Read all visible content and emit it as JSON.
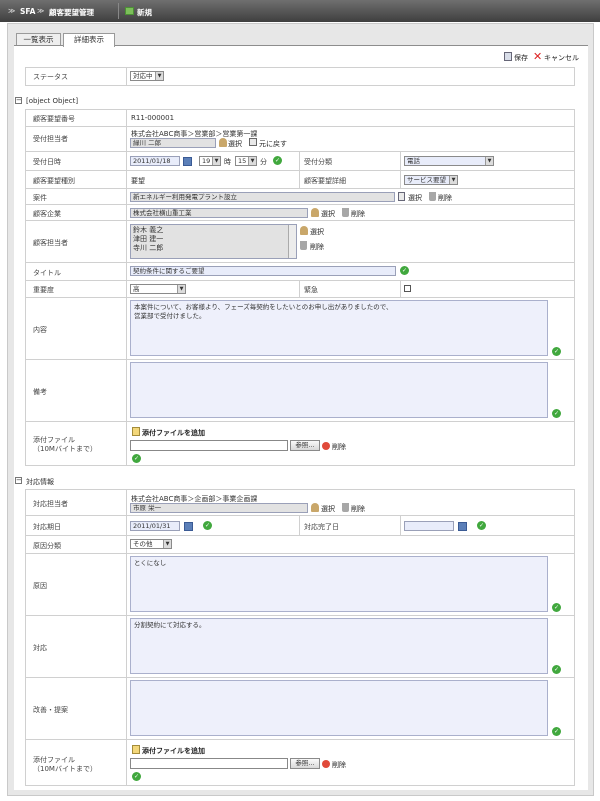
{
  "header": {
    "app": "SFA",
    "module": "顧客要望管理",
    "new_tab": "新規"
  },
  "tabs": [
    {
      "label": "一覧表示"
    },
    {
      "label": "詳細表示"
    }
  ],
  "toolbar": {
    "save": "保存",
    "cancel": "キャンセル"
  },
  "status": {
    "label": "ステータス",
    "value": "対応中"
  },
  "section1": {
    "title": {
      "label": "タイトル",
      "value": "契約条件に関するご要望"
    },
    "number": {
      "label": "顧客要望番号",
      "value": "R11-000001"
    },
    "receiver": {
      "label": "受付担当者",
      "org": "株式会社ABC商事＞営業部＞営業第一課",
      "name": "緑川 二郎",
      "select": "選択",
      "revert": "元に戻す"
    },
    "received_at": {
      "label": "受付日時",
      "date": "2011/01/18",
      "hour": "19",
      "hour_unit": "時",
      "minute": "15",
      "minute_unit": "分"
    },
    "reception_type": {
      "label": "受付分類",
      "value": "電話"
    },
    "type": {
      "label": "顧客要望種別",
      "value": "要望"
    },
    "detail": {
      "label": "顧客要望詳細",
      "value": "サービス要望"
    },
    "project": {
      "label": "案件",
      "value": "新エネルギー利用発電プラント設立",
      "select": "選択",
      "delete": "削除"
    },
    "company": {
      "label": "顧客企業",
      "value": "株式会社横山重工業",
      "select": "選択",
      "delete": "削除"
    },
    "contacts": {
      "label": "顧客担当者",
      "items": [
        "鈴木 義之",
        "津田 建一",
        "寺川 二郎"
      ],
      "select": "選択",
      "delete": "削除"
    },
    "priority": {
      "label": "重要度",
      "value": "高"
    },
    "urgent": {
      "label": "緊急"
    },
    "content": {
      "label": "内容",
      "line1": "本案件について、お客様より、フェーズ毎契約をしたいとのお申し出がありましたので、",
      "line2": "営業部で受付けました。"
    },
    "memo": {
      "label": "備考",
      "value": ""
    },
    "attach": {
      "label1": "添付ファイル",
      "label2": "（10Mバイトまで）",
      "add": "添付ファイルを追加",
      "browse": "参照...",
      "delete": "削除"
    }
  },
  "section2": {
    "title": "対応情報",
    "handler": {
      "label": "対応担当者",
      "org": "株式会社ABC商事＞企画部＞事業企画課",
      "name": "市原 栄一",
      "select": "選択",
      "delete": "削除"
    },
    "due": {
      "label": "対応期日",
      "date": "2011/01/31"
    },
    "done": {
      "label": "対応完了日",
      "date": ""
    },
    "cause_type": {
      "label": "原因分類",
      "value": "その他"
    },
    "cause": {
      "label": "原因",
      "value": "とくになし"
    },
    "response": {
      "label": "対応",
      "value": "分割契約にて対応する。"
    },
    "improve": {
      "label": "改善・提案",
      "value": ""
    },
    "attach": {
      "label1": "添付ファイル",
      "label2": "（10Mバイトまで）",
      "add": "添付ファイルを追加",
      "browse": "参照...",
      "delete": "削除"
    }
  }
}
